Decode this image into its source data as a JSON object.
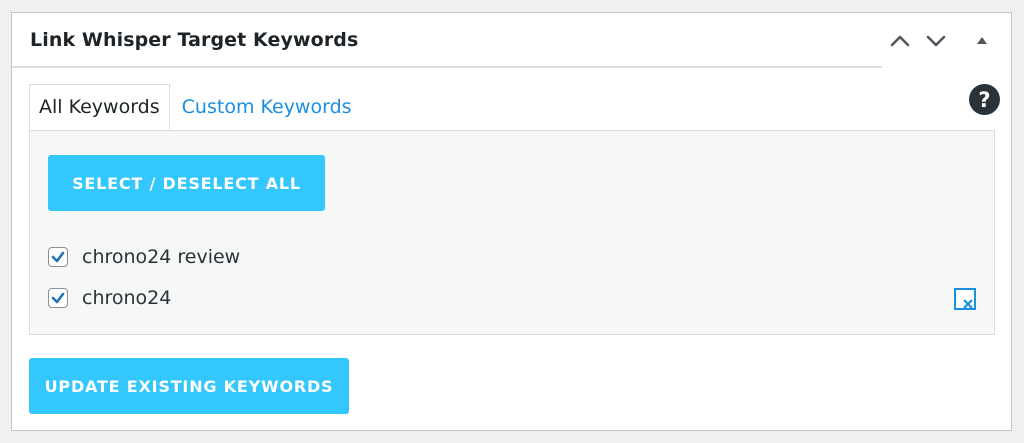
{
  "panel": {
    "title": "Link Whisper Target Keywords"
  },
  "header_controls": {
    "move_up_icon": "chevron-up-icon",
    "move_down_icon": "chevron-down-icon",
    "toggle_icon": "triangle-up-icon"
  },
  "tabs": [
    {
      "label": "All Keywords",
      "active": true
    },
    {
      "label": "Custom Keywords",
      "active": false
    }
  ],
  "help": {
    "icon": "question-circle-icon",
    "glyph": "?"
  },
  "select_all_button": {
    "label": "SELECT / DESELECT ALL"
  },
  "keywords": [
    {
      "label": "chrono24 review",
      "checked": true
    },
    {
      "label": "chrono24",
      "checked": true
    }
  ],
  "update_button": {
    "label": "UPDATE EXISTING KEYWORDS"
  },
  "colors": {
    "accent_button": "#33c7fd",
    "link": "#1a8fe0",
    "checkmark": "#2271b1",
    "help_bg": "#2c3338"
  }
}
